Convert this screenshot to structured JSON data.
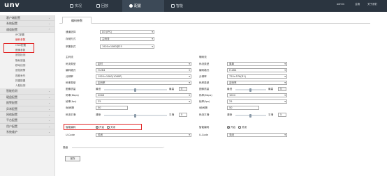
{
  "header": {
    "logo": "unv",
    "nav": [
      {
        "label": "实况"
      },
      {
        "label": "回放"
      },
      {
        "label": "配置"
      },
      {
        "label": "智能"
      }
    ],
    "user": "admin",
    "logout": "注销",
    "about": "关于我们"
  },
  "sidebar": {
    "groups_top": [
      {
        "label": "客户端配置"
      },
      {
        "label": "系统配置"
      },
      {
        "label": "通道配置"
      }
    ],
    "items": [
      {
        "label": "IPC配置"
      },
      {
        "label": "编码参数"
      },
      {
        "label": "OSD配置"
      },
      {
        "label": "图像参数"
      },
      {
        "label": "遮挡检测"
      },
      {
        "label": "隐私遮盖"
      },
      {
        "label": "移动侦测"
      },
      {
        "label": "遮挡报警"
      },
      {
        "label": "视频丢失"
      },
      {
        "label": "抓图配置"
      },
      {
        "label": "人脸检测"
      }
    ],
    "groups_bottom": [
      {
        "label": "智能检测"
      },
      {
        "label": "硬盘配置"
      },
      {
        "label": "报警配置"
      },
      {
        "label": "异常配置"
      },
      {
        "label": "网络配置"
      },
      {
        "label": "平台配置"
      },
      {
        "label": "用户配置"
      },
      {
        "label": "系统维护"
      }
    ]
  },
  "tab": "编码参数",
  "top_form": {
    "channel_label": "通道选择",
    "channel_value": "D3 (IPC)",
    "storage_label": "存储方式",
    "storage_value": "主码流",
    "capture_label": "采集制式",
    "capture_value": "1920×1080@25"
  },
  "main_stream": {
    "header": "主码流",
    "stream_type_label": "码流类型",
    "stream_type": "定时",
    "encoding_label": "编码格式",
    "encoding": "H.264",
    "resolution_label": "分辨率",
    "resolution": "1920×1080(1080P)",
    "bitrate_type_label": "码率类型",
    "bitrate_type": "定码率",
    "quality_label": "图像质量",
    "quality_low": "最低",
    "quality_high": "最高",
    "quality_value": "5",
    "bitrate_label": "码率(Kbps)",
    "bitrate": "2048",
    "fps_label": "帧率(fps)",
    "fps": "25",
    "iframe_label": "I帧间隔",
    "iframe": "50",
    "smooth_label": "码流平滑",
    "smooth_low": "清晰",
    "smooth_high": "平滑",
    "smooth_value": "5",
    "smart_label": "智能编码",
    "smart_on": "开启",
    "smart_off": "关闭",
    "ucode_label": "U-Code",
    "ucode": "关闭"
  },
  "sub_stream": {
    "header": "辅码流",
    "stream_type_label": "码流类型",
    "stream_type": "简单",
    "encoding_label": "编码格式",
    "encoding": "H.264",
    "resolution_label": "分辨率",
    "resolution": "720×576(D1)",
    "bitrate_type_label": "码率类型",
    "bitrate_type": "定码率",
    "quality_label": "图像质量",
    "quality_low": "最低",
    "quality_high": "最高",
    "quality_value": "5",
    "bitrate_label": "码率(Kbps)",
    "bitrate": "1024",
    "fps_label": "帧率(fps)",
    "fps": "25",
    "iframe_label": "I帧间隔",
    "iframe": "50",
    "smooth_label": "码流平滑",
    "smooth_low": "清晰",
    "smooth_high": "平滑",
    "smooth_value": "5",
    "smart_label": "智能编码",
    "smart_on": "开启",
    "smart_off": "关闭",
    "ucode_label": "U-Code",
    "ucode": "关闭"
  },
  "advanced_label": "高级",
  "save_label": "保存"
}
